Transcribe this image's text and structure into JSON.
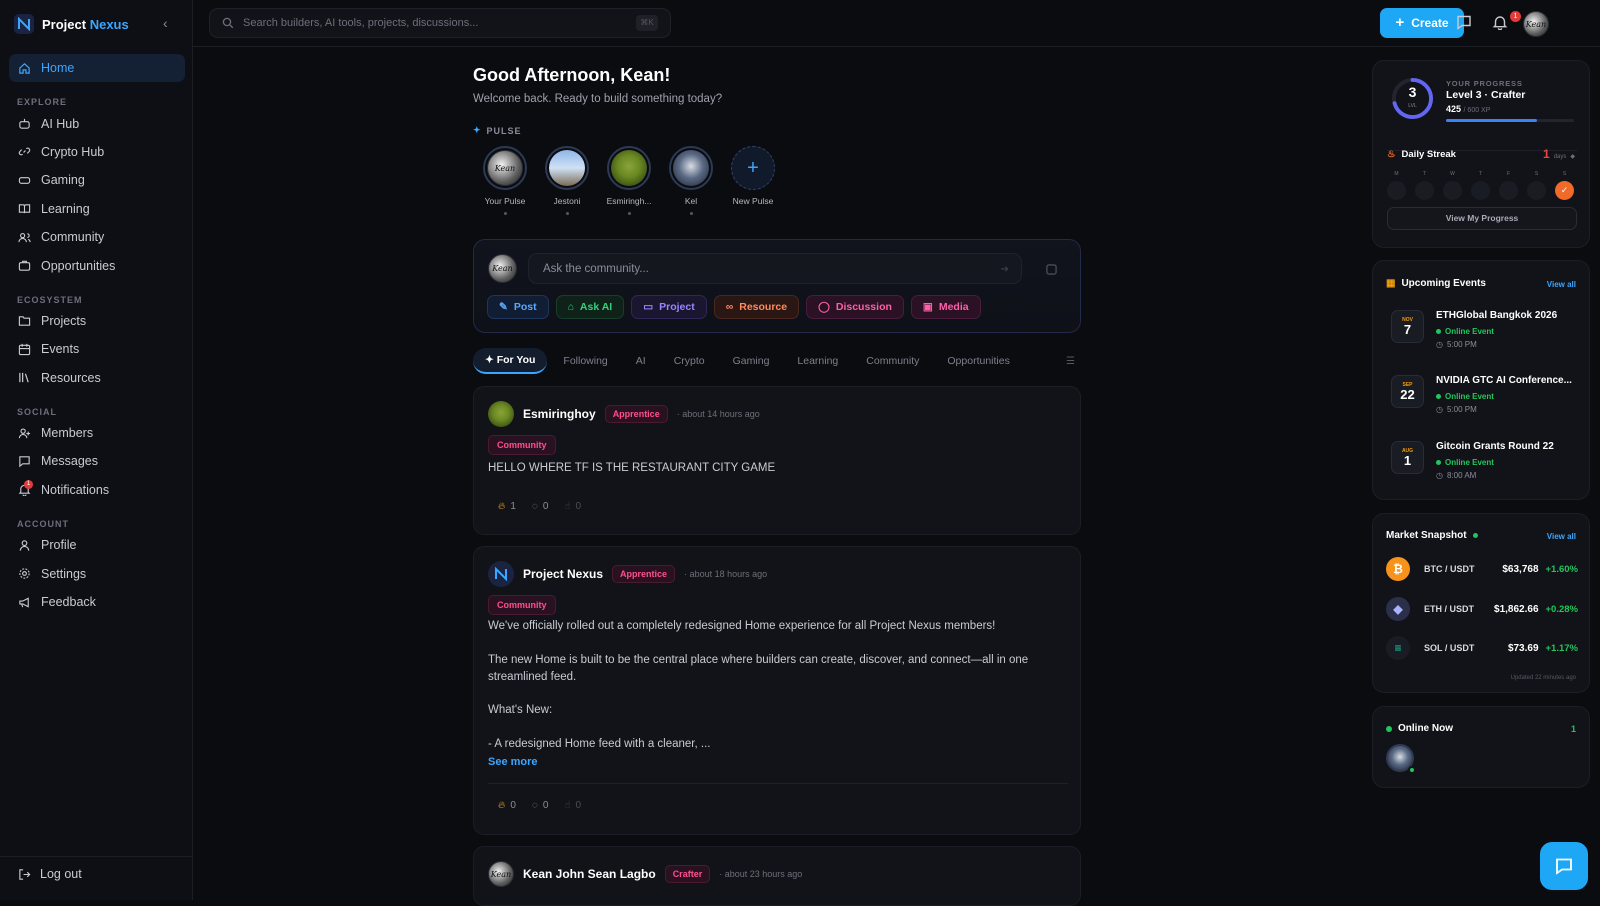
{
  "brand": {
    "name_a": "Project",
    "name_b": "Nexus"
  },
  "search": {
    "placeholder": "Search builders, AI tools, projects, discussions...",
    "shortcut": "⌘K"
  },
  "topbar": {
    "create_label": "Create",
    "notif_count": "1"
  },
  "sidebar": {
    "home": "Home",
    "sections": {
      "explore": "EXPLORE",
      "ecosystem": "ECOSYSTEM",
      "social": "SOCIAL",
      "account": "ACCOUNT"
    },
    "explore": [
      "AI Hub",
      "Crypto Hub",
      "Gaming",
      "Learning",
      "Community",
      "Opportunities"
    ],
    "ecosystem": [
      "Projects",
      "Events",
      "Resources"
    ],
    "social": [
      "Members",
      "Messages",
      "Notifications"
    ],
    "notifications_badge": "1",
    "account": [
      "Profile",
      "Settings",
      "Feedback"
    ],
    "logout": "Log out"
  },
  "main": {
    "greeting": "Good Afternoon, Kean!",
    "welcome": "Welcome back. Ready to build something today?",
    "pulse_label": "PULSE",
    "pulses": [
      "Your Pulse",
      "Jestoni",
      "Esmiringh...",
      "Kel",
      "New Pulse"
    ],
    "composer": {
      "placeholder": "Ask the community...",
      "chips": [
        "Post",
        "Ask AI",
        "Project",
        "Resource",
        "Discussion",
        "Media"
      ]
    },
    "tabs": [
      "For You",
      "Following",
      "AI",
      "Crypto",
      "Gaming",
      "Learning",
      "Community",
      "Opportunities"
    ],
    "posts": [
      {
        "author": "Esmiringhoy",
        "rank": "Apprentice",
        "time": "· about 14 hours ago",
        "category": "Community",
        "body": "HELLO WHERE TF IS THE RESTAURANT CITY GAME",
        "likes": "1",
        "comments": "0",
        "shares": "0"
      },
      {
        "author": "Project Nexus",
        "rank": "Apprentice",
        "time": "· about 18 hours ago",
        "category": "Community",
        "p1": "We've officially rolled out a completely redesigned Home experience for all Project Nexus members!",
        "p2a": "The new Home is built to be the central place where builders can create, discover, and connect—all in one",
        "p2b": "streamlined feed.",
        "p3": "What's New:",
        "p4": "- A redesigned Home feed with a cleaner, ...",
        "see_more": "See more",
        "likes": "0",
        "comments": "0",
        "shares": "0"
      },
      {
        "author": "Kean John Sean Lagbo",
        "rank": "Crafter",
        "time": "· about 23 hours ago"
      }
    ]
  },
  "progress": {
    "label": "YOUR PROGRESS",
    "level_num": "3",
    "level_word": "LVL",
    "level_title": "Level 3 · Crafter",
    "xp": "425",
    "xp_total": "/ 600 XP",
    "xp_fraction": 0.708,
    "streak_title": "Daily Streak",
    "streak_count": "1",
    "streak_unit": "days",
    "week": [
      "M",
      "T",
      "W",
      "T",
      "F",
      "S",
      "S"
    ],
    "done_mark": "✓",
    "button": "View My Progress"
  },
  "events": {
    "title": "Upcoming Events",
    "view_all": "View all",
    "items": [
      {
        "month": "NOV",
        "day": "7",
        "title": "ETHGlobal Bangkok 2026",
        "status": "Online Event",
        "time": "5:00 PM"
      },
      {
        "month": "SEP",
        "day": "22",
        "title": "NVIDIA GTC AI Conference...",
        "status": "Online Event",
        "time": "5:00 PM"
      },
      {
        "month": "AUG",
        "day": "1",
        "title": "Gitcoin Grants Round 22",
        "status": "Online Event",
        "time": "8:00 AM"
      }
    ]
  },
  "market": {
    "title": "Market Snapshot",
    "view_all": "View all",
    "rows": [
      {
        "pair": "BTC / USDT",
        "price": "$63,768",
        "change": "+1.60%",
        "color": "#f7931a",
        "glyph": "₿"
      },
      {
        "pair": "ETH / USDT",
        "price": "$1,862.66",
        "change": "+0.28%",
        "color": "#2b2f4a",
        "glyph": "◆"
      },
      {
        "pair": "SOL / USDT",
        "price": "$73.69",
        "change": "+1.17%",
        "color": "#1a1c23",
        "glyph": "≡"
      }
    ],
    "updated": "Updated 22 minutes ago"
  },
  "online": {
    "title": "Online Now",
    "count": "1"
  },
  "colors": {
    "accent": "#1ea7f5",
    "rank": "#ff4f8d",
    "positive": "#22c55e",
    "streak": "#f06a2a"
  }
}
